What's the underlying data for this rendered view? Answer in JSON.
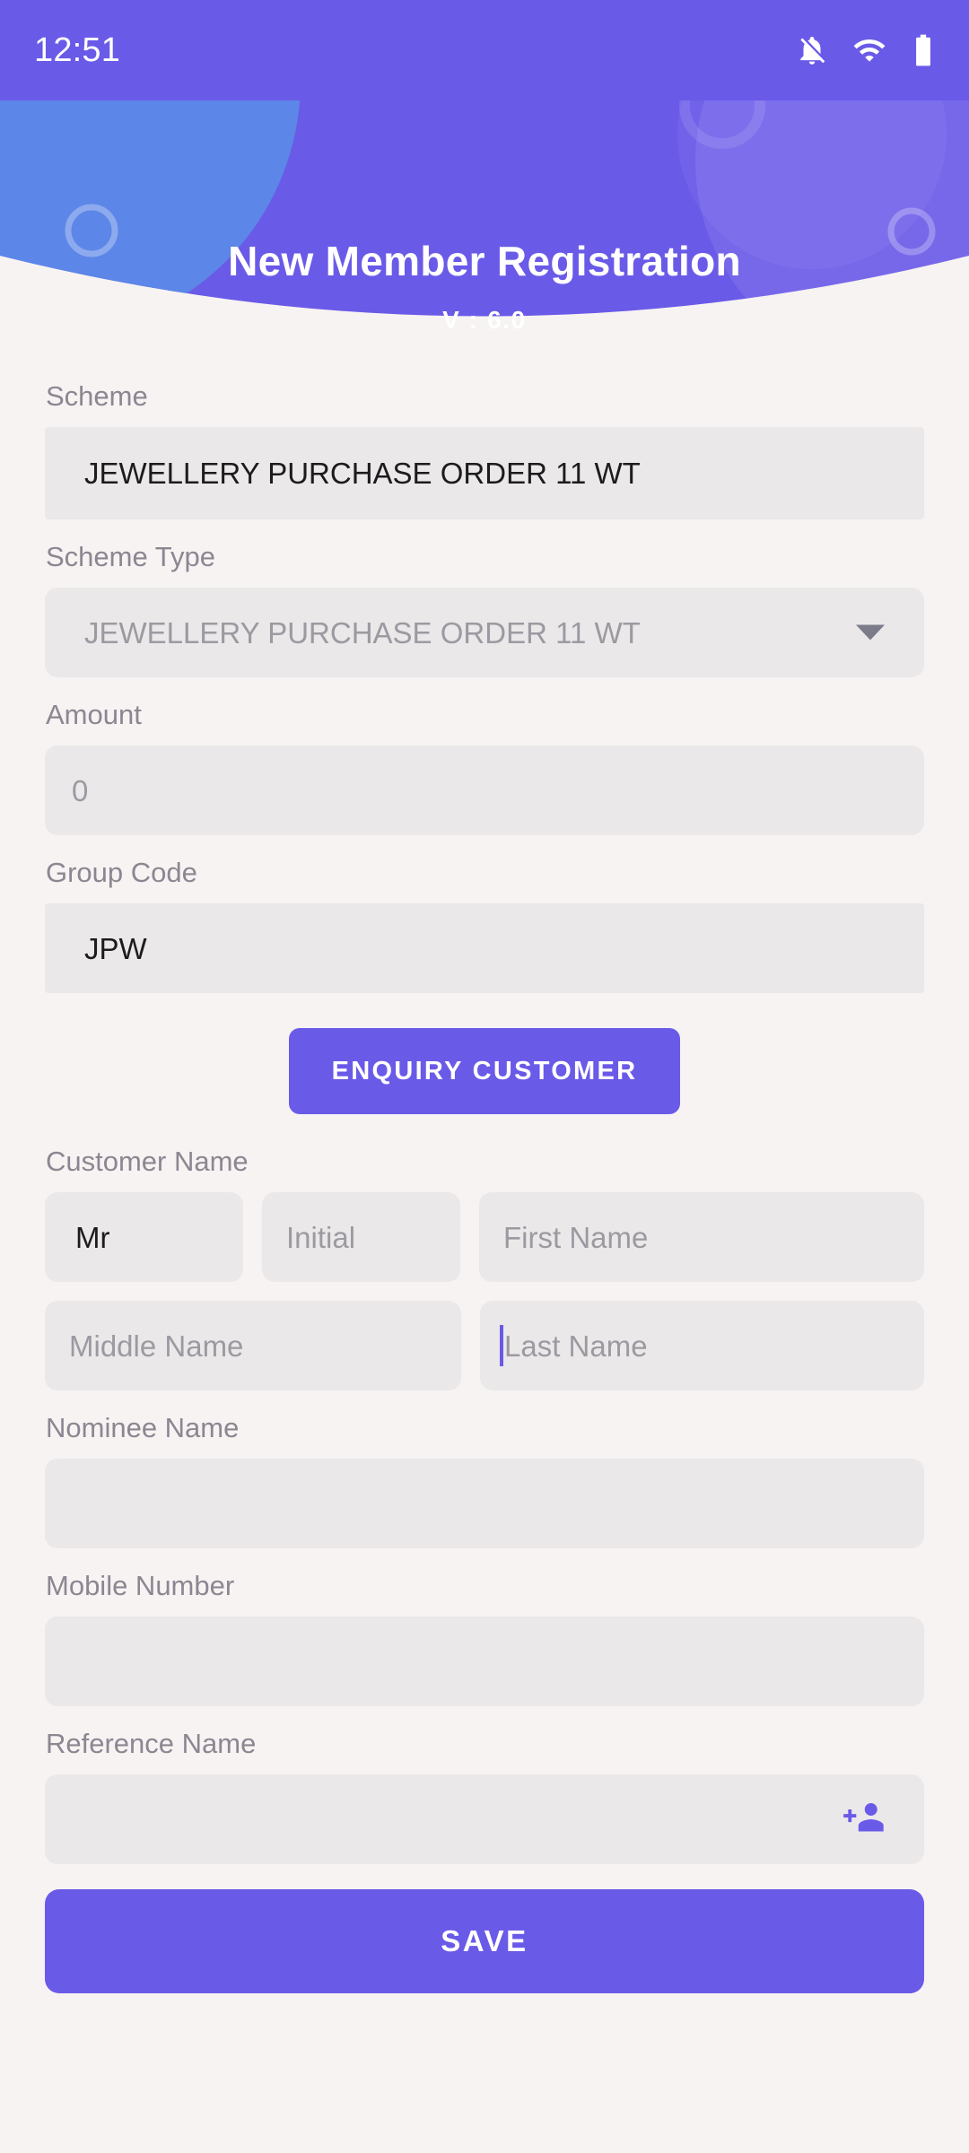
{
  "theme": {
    "accent": "#6a5ae8",
    "header_light_circle": "#5b8ae6",
    "page_bg": "#f7f3f2",
    "field_bg": "#ebe8e9",
    "label_color": "#8b8792",
    "value_color": "#1c1c1e",
    "placeholder_color": "#9c9aa1"
  },
  "statusbar": {
    "time": "12:51",
    "icons": [
      "notifications-off-icon",
      "wifi-icon",
      "battery-icon"
    ]
  },
  "header": {
    "title": "New Member Registration",
    "version": "V : 6.0"
  },
  "form": {
    "scheme": {
      "label": "Scheme",
      "value": "JEWELLERY PURCHASE ORDER 11 WT",
      "filled": true
    },
    "scheme_type": {
      "label": "Scheme Type",
      "value": "JEWELLERY PURCHASE ORDER 11 WT",
      "filled": false,
      "icon": "chevron-down-icon"
    },
    "amount": {
      "label": "Amount",
      "value": "0",
      "filled": false
    },
    "group_code": {
      "label": "Group Code",
      "value": "JPW",
      "filled": true
    },
    "enquiry_button": {
      "label": "ENQUIRY CUSTOMER"
    },
    "customer_name": {
      "label": "Customer Name",
      "title_value": "Mr",
      "initial_placeholder": "Initial",
      "first_placeholder": "First Name",
      "middle_placeholder": "Middle Name",
      "last_placeholder": "Last Name"
    },
    "nominee_name": {
      "label": "Nominee Name",
      "value": ""
    },
    "mobile_number": {
      "label": "Mobile Number",
      "value": ""
    },
    "reference_name": {
      "label": "Reference Name",
      "value": "",
      "icon": "add-person-icon"
    },
    "save_button": {
      "label": "SAVE"
    }
  }
}
